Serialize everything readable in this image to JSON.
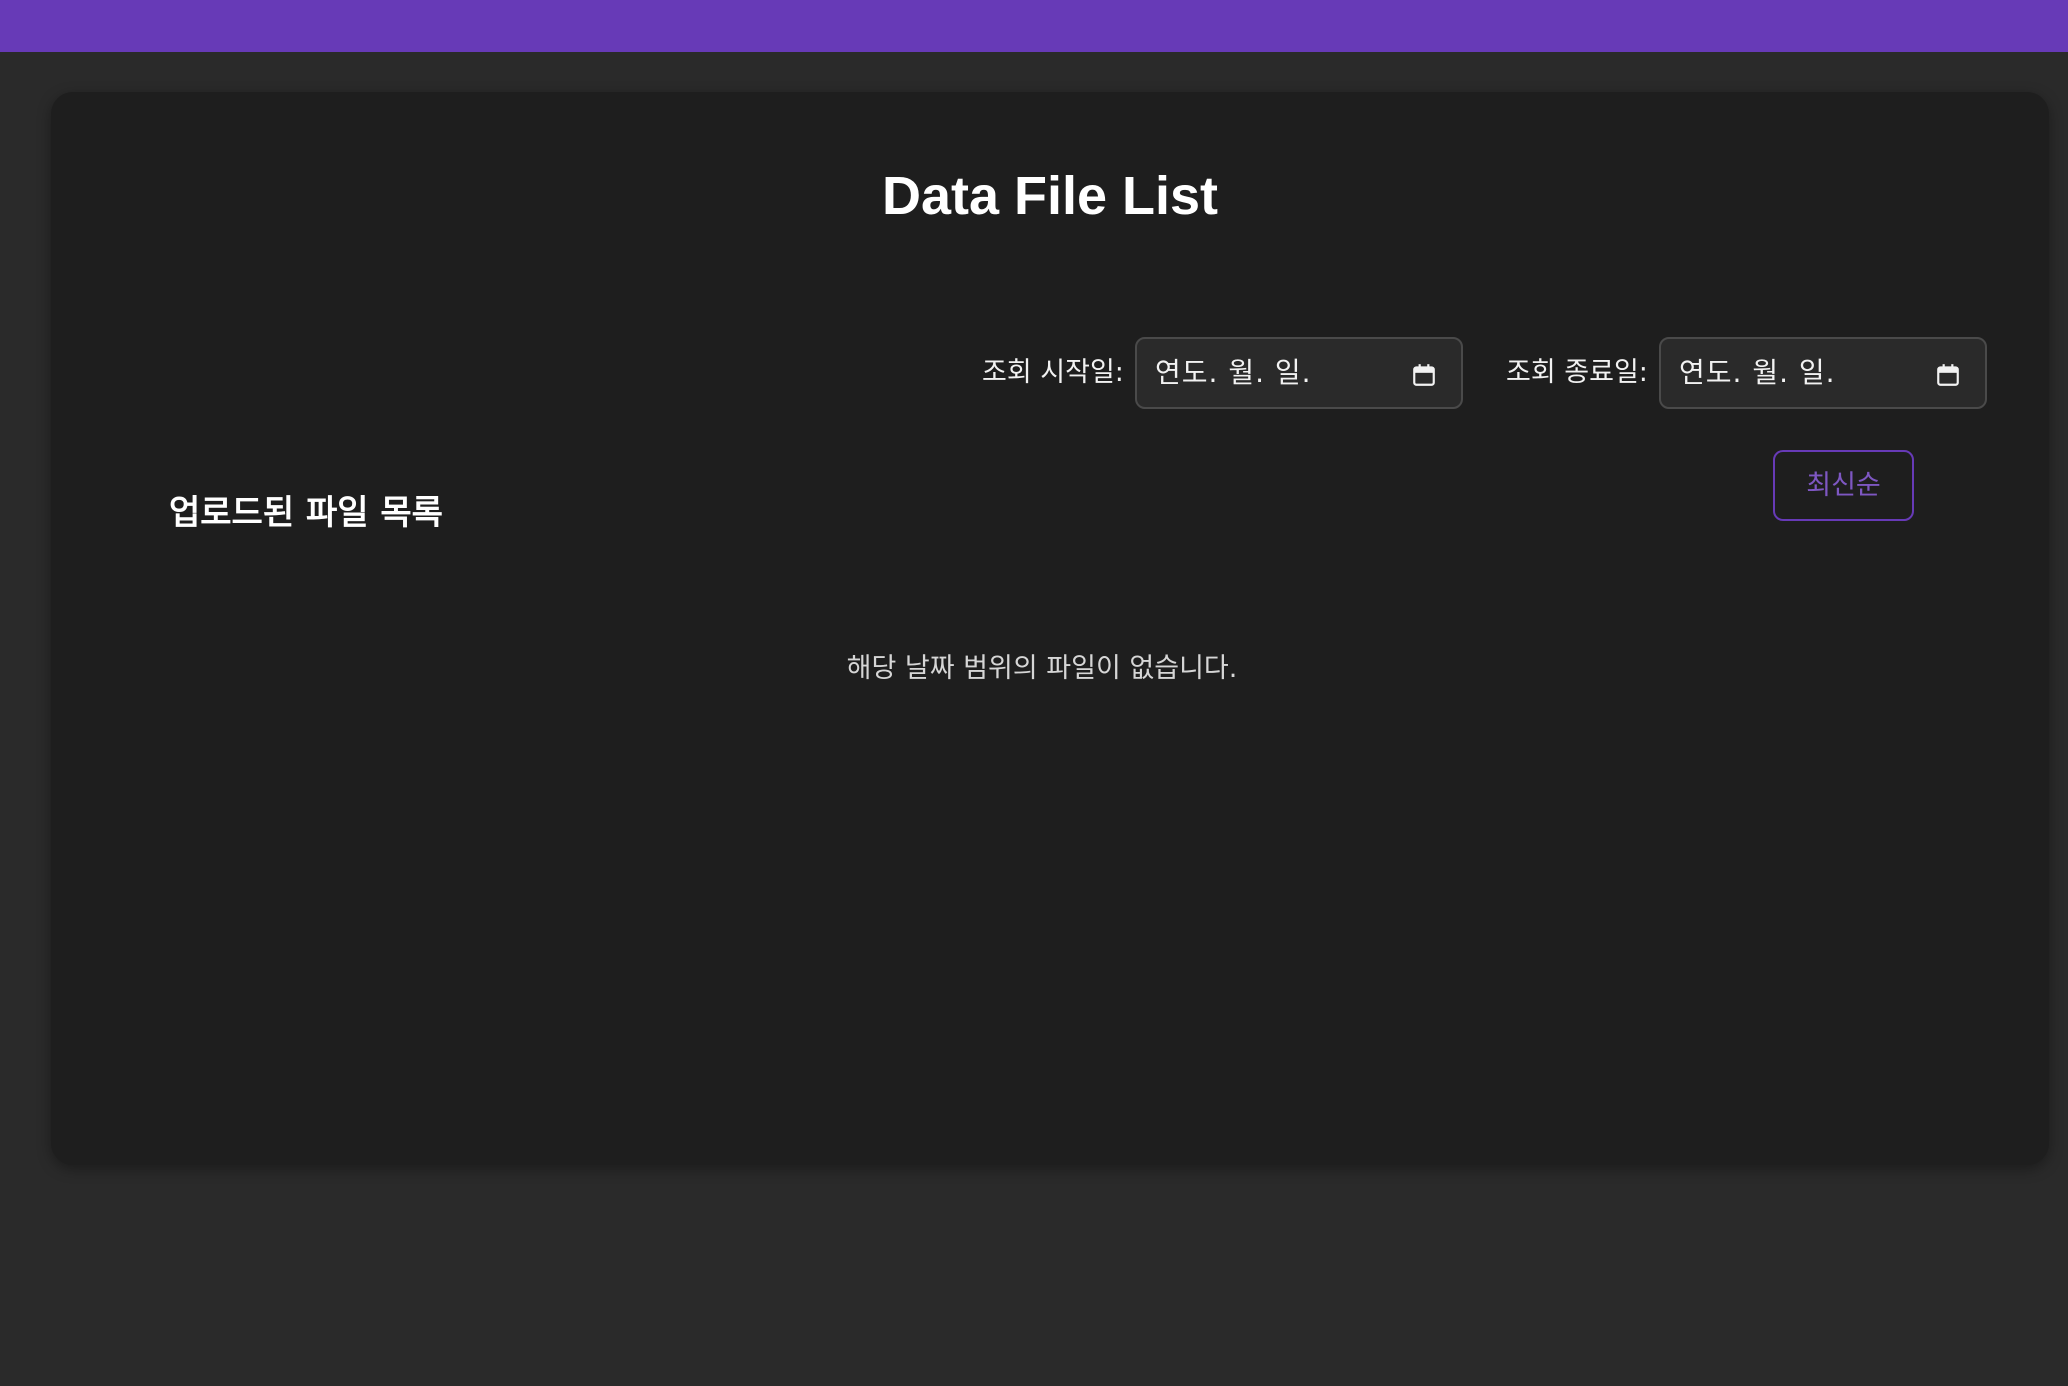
{
  "header": {
    "accent_color": "#673ab7"
  },
  "page": {
    "title": "Data File List"
  },
  "filters": {
    "start_label": "조회 시작일:",
    "start_value": "연도. 월. 일.",
    "end_label": "조회 종료일:",
    "end_value": "연도. 월. 일.",
    "icon": "calendar-icon"
  },
  "files": {
    "section_title": "업로드된 파일 목록",
    "sort_label": "최신순",
    "empty_message": "해당 날짜 범위의 파일이 없습니다."
  }
}
